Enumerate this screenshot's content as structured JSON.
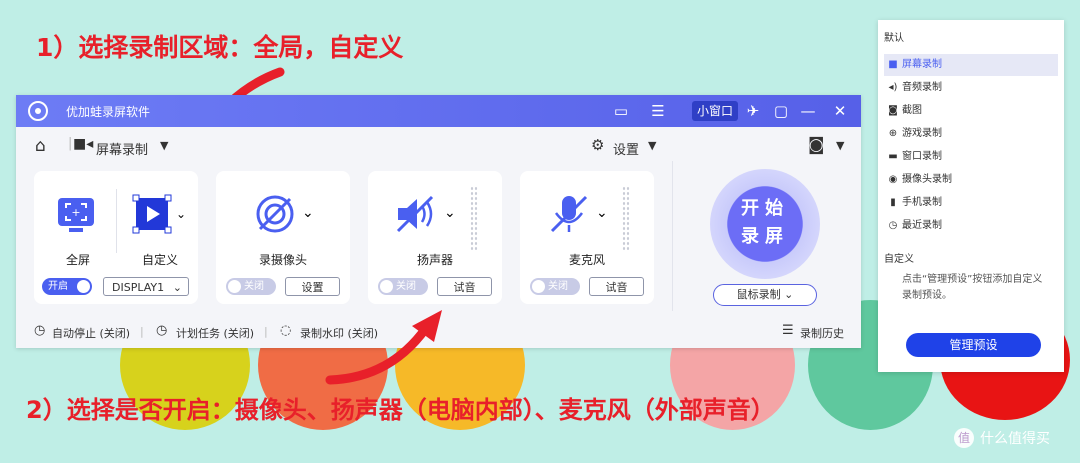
{
  "annotations": {
    "top": "1）选择录制区域：全局，自定义",
    "bottom": "2）选择是否开启：摄像头、扬声器（电脑内部）、麦克风（外部声音）"
  },
  "window": {
    "title": "优加蛙录屏软件",
    "mini_window_label": "小窗口"
  },
  "toolbar": {
    "mode_label": "屏幕录制",
    "settings_label": "设置"
  },
  "cards": {
    "fullscreen_label": "全屏",
    "custom_label": "自定义",
    "display_toggle": "开启",
    "display_select": "DISPLAY1",
    "camera_label": "录摄像头",
    "camera_toggle": "关闭",
    "camera_button": "设置",
    "speaker_label": "扬声器",
    "speaker_toggle": "关闭",
    "speaker_button": "试音",
    "mic_label": "麦克风",
    "mic_toggle": "关闭",
    "mic_button": "试音"
  },
  "record": {
    "line1": "开始",
    "line2": "录屏",
    "mouse_mode": "鼠标录制"
  },
  "status_bar": {
    "auto_stop": "自动停止 (关闭)",
    "schedule": "计划任务 (关闭)",
    "watermark": "录制水印 (关闭)",
    "history": "录制历史"
  },
  "panel": {
    "default_header": "默认",
    "items": [
      {
        "label": "屏幕录制",
        "icon": "video-icon"
      },
      {
        "label": "音频录制",
        "icon": "speaker-icon"
      },
      {
        "label": "截图",
        "icon": "camera-icon"
      },
      {
        "label": "游戏录制",
        "icon": "gamepad-icon"
      },
      {
        "label": "窗口录制",
        "icon": "window-icon"
      },
      {
        "label": "摄像头录制",
        "icon": "webcam-icon"
      },
      {
        "label": "手机录制",
        "icon": "phone-icon"
      },
      {
        "label": "最近录制",
        "icon": "clock-icon"
      }
    ],
    "custom_header": "自定义",
    "custom_hint": "点击“管理预设”按钮添加自定义录制预设。",
    "manage_button": "管理预设"
  },
  "watermark": "什么值得买",
  "colors": {
    "accent": "#4a5ff0",
    "annotation": "#e8202a",
    "background": "#bfeee6"
  }
}
